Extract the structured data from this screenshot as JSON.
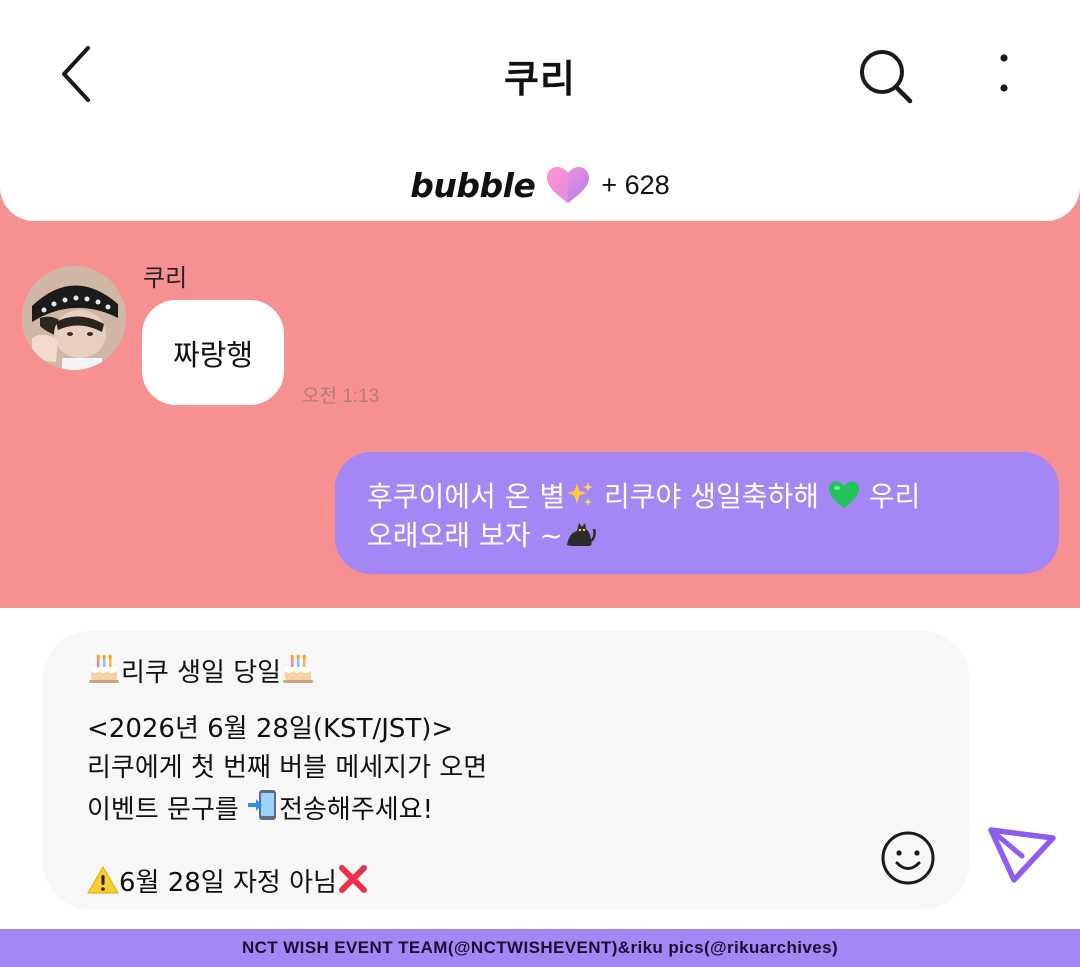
{
  "header": {
    "title": "쿠리",
    "brand": "bubble",
    "count": "+ 628"
  },
  "chat": {
    "sender": "쿠리",
    "incoming": {
      "text": "짜랑행",
      "time": "오전 1:13"
    },
    "outgoing": {
      "line1_a": "후쿠이에서 온 별",
      "line1_b": " 리쿠야 생일축하해 ",
      "line1_c": " 우리",
      "line2": "오래오래 보자 ~"
    }
  },
  "composer": {
    "line1": "리쿠 생일 당일",
    "line2": "<2026년 6월 28일(KST/JST)>",
    "line3": "리쿠에게 첫 번째 버블 메세지가 오면",
    "line4_a": "이벤트 문구를 ",
    "line4_b": "전송해주세요!",
    "line5": "6월 28일 자정 아님"
  },
  "footer": {
    "credit": "NCT WISH EVENT TEAM(@NCTWISHEVENT)&riku pics(@rikuarchives)"
  },
  "colors": {
    "chat_bg": "#f79191",
    "accent": "#a586f5",
    "composer_bg": "#f7f7f7"
  },
  "icons": [
    "back-arrow-icon",
    "search-icon",
    "more-vertical-icon",
    "heart-icon",
    "sparkles-icon",
    "green-heart-icon",
    "black-cat-icon",
    "cake-icon",
    "phone-arrow-icon",
    "warning-icon",
    "cross-mark-icon",
    "smile-icon",
    "send-icon"
  ]
}
